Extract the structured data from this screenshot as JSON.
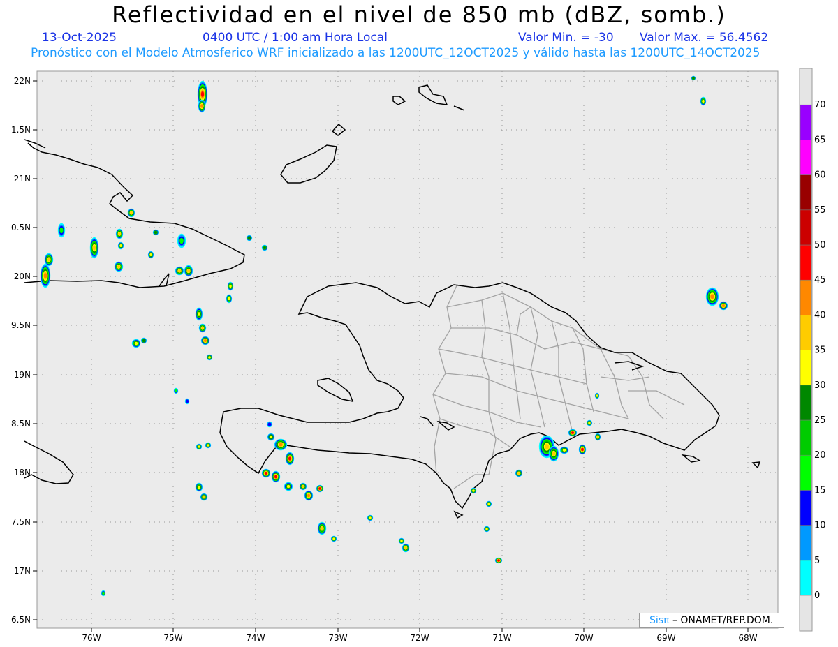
{
  "header": {
    "title": "Reflectividad en el nivel de 850 mb (dBZ, somb.)",
    "date": "13-Oct-2025",
    "time": "0400 UTC / 1:00 am Hora Local",
    "vmin": "Valor Min. = -30",
    "vmax": "Valor Max. = 56.4562",
    "forecast": "Pronóstico con el Modelo Atmosferico WRF inicializado a las 1200UTC_12OCT2025 y válido hasta las  1200UTC_14OCT2025"
  },
  "map": {
    "lon_range": [
      -76.65,
      -67.7
    ],
    "lat_range": [
      16.45,
      22.1
    ],
    "lat_ticks": [
      "22N",
      "1.5N",
      "21N",
      "0.5N",
      "20N",
      "9.5N",
      "19N",
      "8.5N",
      "18N",
      "7.5N",
      "17N",
      "6.5N"
    ],
    "lon_ticks": [
      "76W",
      "75W",
      "74W",
      "73W",
      "72W",
      "71W",
      "70W",
      "69W",
      "68W"
    ],
    "grid": true,
    "background_color": "#ebebeb",
    "coast_color": "#000000",
    "border_color": "#a0a0a0"
  },
  "colorbar": {
    "labels": [
      "0",
      "5",
      "10",
      "15",
      "20",
      "25",
      "30",
      "35",
      "40",
      "45",
      "50",
      "55",
      "60",
      "65",
      "70"
    ],
    "colors": [
      "#00ffff",
      "#0099ff",
      "#0000ff",
      "#00ff00",
      "#00cc00",
      "#008800",
      "#ffff00",
      "#ffcc00",
      "#ff8800",
      "#ff0000",
      "#cc0000",
      "#990000",
      "#ff00ff",
      "#9900ff"
    ]
  },
  "credit": {
    "sis": "Sisπ",
    "rest": "– ONAMET/REP.DOM."
  }
}
